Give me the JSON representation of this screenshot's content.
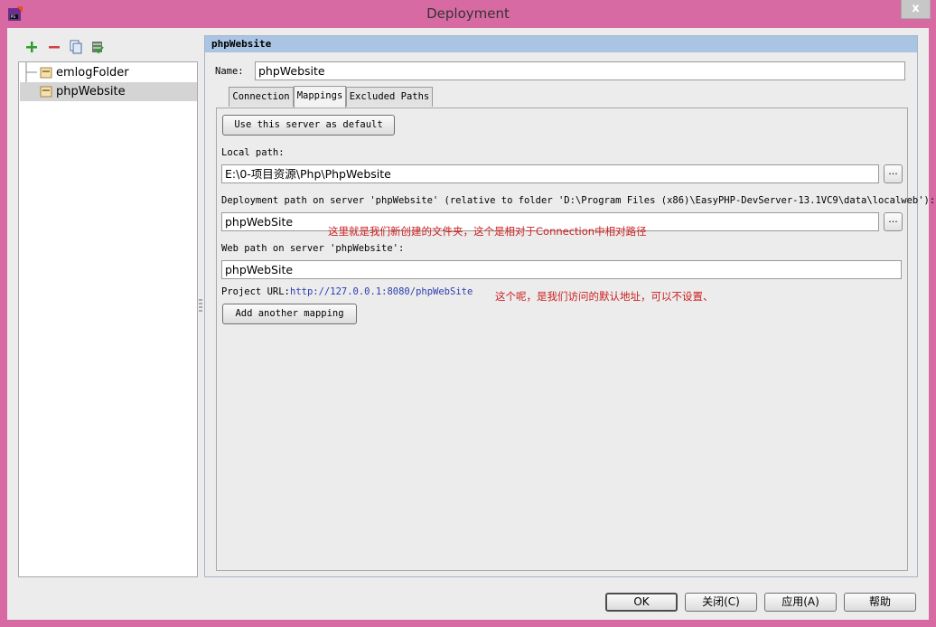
{
  "window": {
    "title": "Deployment",
    "close_label": "x"
  },
  "colors": {
    "frame": "#d86aa3",
    "panel_header": "#aac4e4",
    "annotation": "#cc1e1e",
    "link": "#2a3fb0"
  },
  "toolbar": {
    "add_icon": "plus-icon",
    "remove_icon": "minus-icon",
    "copy_icon": "copy-icon",
    "default_icon": "server-default-icon"
  },
  "tree": {
    "items": [
      {
        "label": "emlogFolder",
        "selected": false
      },
      {
        "label": "phpWebsite",
        "selected": true
      }
    ]
  },
  "panel": {
    "header": "phpWebsite",
    "name_label": "Name:",
    "name_value": "phpWebsite",
    "tabs": [
      {
        "label": "Connection",
        "active": false
      },
      {
        "label": "Mappings",
        "active": true
      },
      {
        "label": "Excluded Paths",
        "active": false
      }
    ],
    "use_default_button": "Use this server as default",
    "local_path_label": "Local path:",
    "local_path_value": "E:\\0-项目资源\\Php\\PhpWebsite",
    "deployment_path_label": "Deployment path on server 'phpWebsite' (relative to folder 'D:\\Program Files (x86)\\EasyPHP-DevServer-13.1VC9\\data\\localweb'):",
    "deployment_path_value": "phpWebSite",
    "web_path_label": "Web path on server 'phpWebsite':",
    "web_path_value": "phpWebSite",
    "project_url_label": "Project URL:",
    "project_url_value": "http://127.0.0.1:8080/phpWebSite",
    "add_mapping_button": "Add another mapping",
    "browse_label": "..."
  },
  "annotations": {
    "deployment_note": "这里就是我们新创建的文件夹，这个是相对于Connection中相对路径",
    "url_note": "这个呢，是我们访问的默认地址，可以不设置、"
  },
  "footer": {
    "ok": "OK",
    "close": "关闭(C)",
    "apply": "应用(A)",
    "help": "帮助"
  }
}
